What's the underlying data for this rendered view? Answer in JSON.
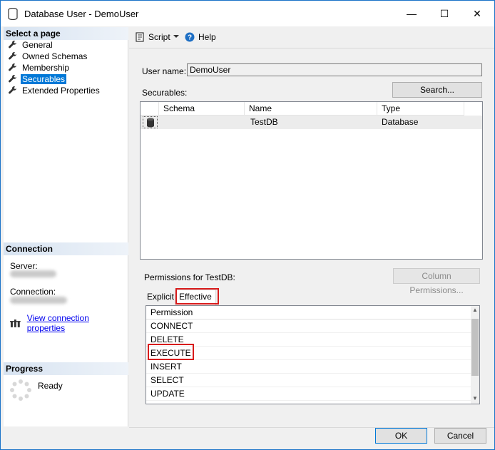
{
  "window": {
    "title": "Database User - DemoUser",
    "minimize_glyph": "—",
    "maximize_glyph": "☐",
    "close_glyph": "✕"
  },
  "left_pane": {
    "select_page_header": "Select a page",
    "pages": [
      {
        "label": "General",
        "icon": "wrench-icon",
        "active": false
      },
      {
        "label": "Owned Schemas",
        "icon": "wrench-icon",
        "active": false
      },
      {
        "label": "Membership",
        "icon": "wrench-icon",
        "active": false
      },
      {
        "label": "Securables",
        "icon": "wrench-icon",
        "active": true
      },
      {
        "label": "Extended Properties",
        "icon": "wrench-icon",
        "active": false
      }
    ],
    "connection_header": "Connection",
    "server_label": "Server:",
    "connection_label": "Connection:",
    "view_connection_link": "View connection properties",
    "progress_header": "Progress",
    "progress_status": "Ready"
  },
  "toolbar": {
    "script_label": "Script",
    "help_label": "Help"
  },
  "main": {
    "user_name_label": "User name:",
    "user_name_value": "DemoUser",
    "securables_label": "Securables:",
    "search_button": "Search...",
    "grid": {
      "columns": [
        "Schema",
        "Name",
        "Type"
      ],
      "rows": [
        {
          "schema": "",
          "name": "TestDB",
          "type": "Database"
        }
      ]
    },
    "permissions_label": "Permissions for TestDB:",
    "column_permissions_button": "Column Permissions...",
    "tabs": [
      "Explicit",
      "Effective"
    ],
    "selected_tab": "Effective",
    "permissions_header": "Permission",
    "permissions": [
      "CONNECT",
      "DELETE",
      "EXECUTE",
      "INSERT",
      "SELECT",
      "UPDATE"
    ]
  },
  "footer": {
    "ok_button": "OK",
    "cancel_button": "Cancel"
  },
  "colors": {
    "accent": "#0078d7",
    "highlight": "#d81b1b",
    "link": "#0000ee"
  }
}
